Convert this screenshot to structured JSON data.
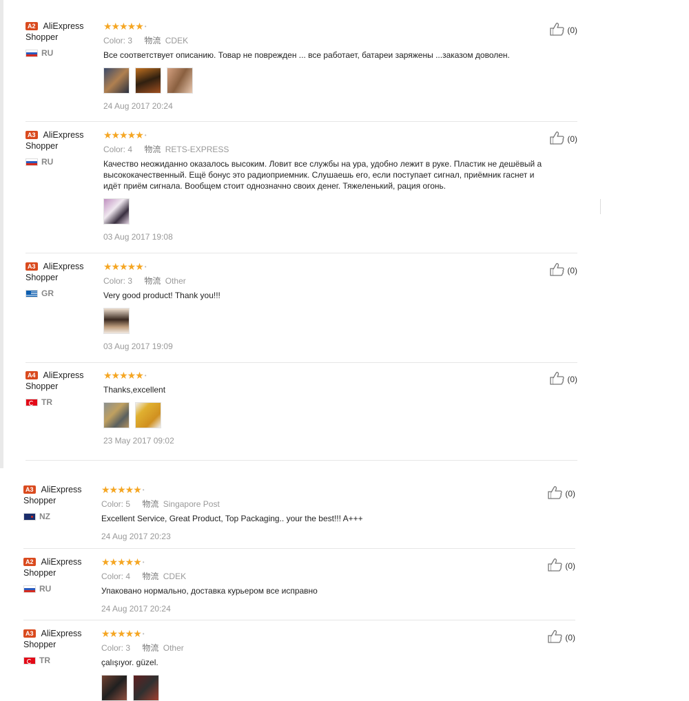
{
  "reviews": [
    {
      "badge": "A2",
      "name_line1": "AliExpress",
      "name_line2": "Shopper",
      "country": "RU",
      "flag": "RU",
      "rating": "★★★★★",
      "color_label": "Color: 3",
      "ship_label": "物流",
      "ship_method": "CDEK",
      "text": "Все соответствует описанию. Товар не поврежден ... все работает, батареи заряжены ...заказом доволен.",
      "photos": [
        "p1",
        "p2",
        "p3"
      ],
      "date": "24 Aug 2017 20:24",
      "helpful": "(0)"
    },
    {
      "badge": "A3",
      "name_line1": "AliExpress",
      "name_line2": "Shopper",
      "country": "RU",
      "flag": "RU",
      "rating": "★★★★★",
      "color_label": "Color: 4",
      "ship_label": "物流",
      "ship_method": "RETS-EXPRESS",
      "text": "Качество неожиданно оказалось высоким. Ловит все службы на ура, удобно лежит в руке. Пластик не дешёвый а высококачественный. Ещё бонус это радиоприемник. Слушаешь его, если поступает сигнал, приёмник гаснет и идёт приём сигнала. Вообщем стоит однозначно своих денег. Тяжеленький, рация огонь.",
      "photos": [
        "p4"
      ],
      "date": "03 Aug 2017 19:08",
      "helpful": "(0)"
    },
    {
      "badge": "A3",
      "name_line1": "AliExpress",
      "name_line2": "Shopper",
      "country": "GR",
      "flag": "GR",
      "rating": "★★★★★",
      "color_label": "Color: 3",
      "ship_label": "物流",
      "ship_method": "Other",
      "text": "Very good product! Thank you!!!",
      "photos": [
        "p5"
      ],
      "date": "03 Aug 2017 19:09",
      "helpful": "(0)"
    },
    {
      "badge": "A4",
      "name_line1": "AliExpress",
      "name_line2": "Shopper",
      "country": "TR",
      "flag": "TR",
      "rating": "★★★★★",
      "color_label": "",
      "ship_label": "",
      "ship_method": "",
      "text": "Thanks,excellent",
      "photos": [
        "p6",
        "p7"
      ],
      "date": "23 May 2017 09:02",
      "helpful": "(0)"
    },
    {
      "badge": "A3",
      "name_line1": "AliExpress",
      "name_line2": "Shopper",
      "country": "NZ",
      "flag": "NZ",
      "rating": "★★★★★",
      "color_label": "Color: 5",
      "ship_label": "物流",
      "ship_method": "Singapore Post",
      "text": "Excellent Service, Great Product, Top Packaging.. your the best!!! A+++",
      "photos": [],
      "date": "24 Aug 2017 20:23",
      "helpful": "(0)"
    },
    {
      "badge": "A2",
      "name_line1": "AliExpress",
      "name_line2": "Shopper",
      "country": "RU",
      "flag": "RU",
      "rating": "★★★★★",
      "color_label": "Color: 4",
      "ship_label": "物流",
      "ship_method": "CDEK",
      "text": "Упаковано нормально, доставка курьером все исправно",
      "photos": [],
      "date": "24 Aug 2017 20:24",
      "helpful": "(0)"
    },
    {
      "badge": "A3",
      "name_line1": "AliExpress",
      "name_line2": "Shopper",
      "country": "TR",
      "flag": "TR",
      "rating": "★★★★★",
      "color_label": "Color: 3",
      "ship_label": "物流",
      "ship_method": "Other",
      "text": "çalışıyor. güzel.",
      "photos": [
        "p8",
        "p9"
      ],
      "date": "",
      "helpful": "(0)"
    }
  ]
}
